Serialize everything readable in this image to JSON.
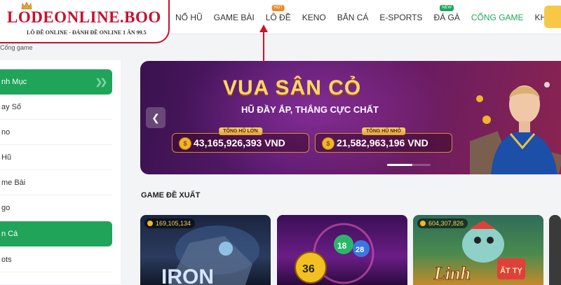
{
  "logo": {
    "title": "LODEONLINE.BOO",
    "tagline": "LÔ ĐỀ ONLINE - ĐÁNH ĐỀ ONLINE 1 ĂN 99.5"
  },
  "nav": {
    "items": [
      {
        "label": "NỔ HŨ"
      },
      {
        "label": "GAME BÀI"
      },
      {
        "label": "LÔ ĐỀ",
        "badge": "HOT"
      },
      {
        "label": "KENO"
      },
      {
        "label": "BẮN CÁ"
      },
      {
        "label": "E-SPORTS"
      },
      {
        "label": "ĐÁ GÀ",
        "badge": "NEW"
      },
      {
        "label": "CỔNG GAME",
        "active": true
      },
      {
        "label": "KHUYẾN MÃI"
      }
    ]
  },
  "breadcrumb": "Cổng game",
  "sidebar": {
    "items": [
      {
        "label": "nh Mục",
        "highlight": true
      },
      {
        "label": "ay Số"
      },
      {
        "label": "no"
      },
      {
        "label": "Hũ"
      },
      {
        "label": "me Bài"
      },
      {
        "label": "go"
      },
      {
        "label": "n Cá",
        "highlight": true
      },
      {
        "label": "ots"
      }
    ]
  },
  "banner": {
    "title": "VUA SÂN CỎ",
    "subtitle": "HŨ ĐẦY ẮP, THẮNG CỰC CHẤT",
    "jackpots": [
      {
        "label": "TỔNG HŨ LỚN",
        "value": "43,165,926,393 VND"
      },
      {
        "label": "TỔNG HŨ NHỎ",
        "value": "21,582,963,196 VND"
      }
    ]
  },
  "section": {
    "title": "GAME ĐỀ XUẤT"
  },
  "games": [
    {
      "count": "169,105,134",
      "art_text": "IRON"
    },
    {
      "count": "",
      "art_numbers": [
        "36",
        "18",
        "28"
      ]
    },
    {
      "count": "604,307,826",
      "art_text": "Linh",
      "art_text2": "ẤT TỴ"
    }
  ],
  "colors": {
    "accent_green": "#20a45a",
    "brand_red": "#c8102e",
    "banner_purple": "#5a1a6e",
    "gold": "#ffd869"
  }
}
